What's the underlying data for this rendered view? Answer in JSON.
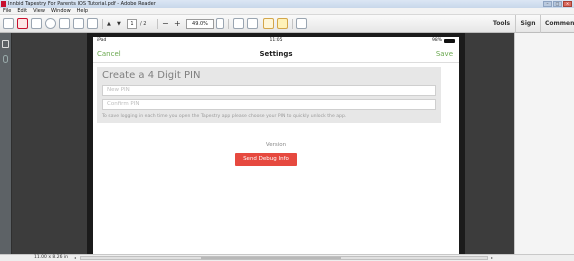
{
  "window": {
    "title": "Innbid Tapestry For Parents IOS Tutorial.pdf - Adobe Reader"
  },
  "menu": [
    "File",
    "Edit",
    "View",
    "Window",
    "Help"
  ],
  "toolbar": {
    "page_current": "1",
    "page_total": "/ 2",
    "zoom": "49.0%",
    "right_tabs": [
      "Tools",
      "Sign",
      "Comment"
    ]
  },
  "ios": {
    "status": {
      "carrier": "iPad",
      "time": "11:05",
      "battery": "98%"
    },
    "nav": {
      "cancel": "Cancel",
      "title": "Settings",
      "save": "Save"
    },
    "pin": {
      "heading": "Create a 4 Digit PIN",
      "new_placeholder": "New PIN",
      "confirm_placeholder": "Confirm PIN",
      "help": "To save logging in each time you open the Tapestry app please choose your PIN to quickly unlock the app."
    },
    "version_label": "Version",
    "debug_button": "Send Debug Info"
  },
  "statusbar": {
    "page_size": "11.00 x 8.26 in"
  },
  "colors": {
    "ios_accent": "#6aa84f",
    "debug_red": "#e6493f",
    "app_icon_red": "#c8102e"
  }
}
